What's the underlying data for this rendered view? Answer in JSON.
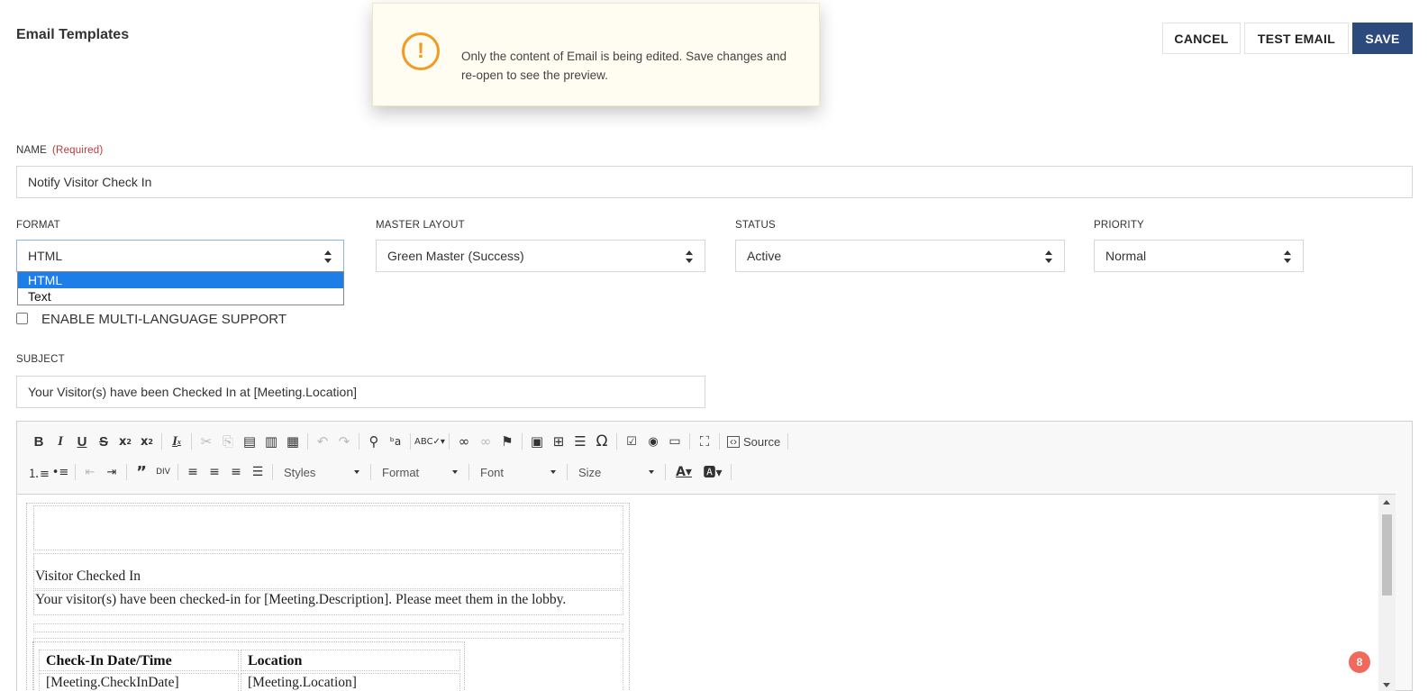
{
  "header": {
    "title": "Email Templates",
    "buttons": {
      "cancel": "CANCEL",
      "test_email": "TEST EMAIL",
      "save": "SAVE"
    }
  },
  "toast": {
    "icon": "exclamation-circle-icon",
    "message": "Only the content of Email is being edited. Save changes and re-open to see the preview."
  },
  "form": {
    "name": {
      "label": "NAME",
      "required": "(Required)",
      "value": "Notify Visitor Check In"
    },
    "format": {
      "label": "FORMAT",
      "value": "HTML",
      "options": [
        "HTML",
        "Text"
      ],
      "highlighted": "HTML"
    },
    "master_layout": {
      "label": "MASTER LAYOUT",
      "value": "Green Master (Success)"
    },
    "status": {
      "label": "STATUS",
      "value": "Active"
    },
    "priority": {
      "label": "PRIORITY",
      "value": "Normal"
    },
    "multi_language": {
      "label": "ENABLE MULTI-LANGUAGE SUPPORT",
      "checked": false
    },
    "subject": {
      "label": "SUBJECT",
      "value": "Your Visitor(s) have been Checked In at [Meeting.Location]"
    }
  },
  "editor": {
    "toolbar_row1": [
      "bold-icon",
      "italic-icon",
      "underline-icon",
      "strikethrough-icon",
      "subscript-icon",
      "superscript-icon",
      "remove-format-icon",
      "cut-icon",
      "copy-icon",
      "paste-icon",
      "paste-text-icon",
      "paste-word-icon",
      "undo-icon",
      "redo-icon",
      "find-icon",
      "replace-icon",
      "spellcheck-icon",
      "link-icon",
      "unlink-icon",
      "anchor-icon",
      "image-icon",
      "table-icon",
      "horizontal-rule-icon",
      "special-char-icon",
      "checkbox-icon",
      "radio-icon",
      "textfield-icon",
      "maximize-icon",
      "source-icon"
    ],
    "source_label": "Source",
    "combos": {
      "styles": "Styles",
      "format": "Format",
      "font": "Font",
      "size": "Size"
    },
    "content": {
      "heading": "Visitor Checked In",
      "body": "Your visitor(s) have been checked-in for [Meeting.Description]. Please meet them in the lobby.",
      "table_headers": [
        "Check-In Date/Time",
        "Location"
      ],
      "table_row": [
        "[Meeting.CheckInDate]",
        "[Meeting.Location]"
      ]
    }
  },
  "notification_badge": "8"
}
